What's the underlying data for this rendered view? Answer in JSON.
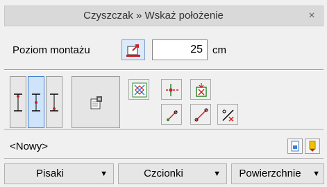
{
  "window": {
    "title": "Czyszczak » Wskaż położenie",
    "close_symbol": "×"
  },
  "level": {
    "label": "Poziom montażu",
    "value": "25",
    "unit": "cm",
    "icon": "mounting-level-icon"
  },
  "anchors": [
    {
      "name": "anchor-top",
      "active": false
    },
    {
      "name": "anchor-center",
      "active": true
    },
    {
      "name": "anchor-bottom",
      "active": false
    }
  ],
  "tools": {
    "properties_icon": "properties-icon",
    "icons": [
      "snap-cross-icon",
      "insert-point-icon",
      "place-on-axis-icon",
      "line-start-icon",
      "line-diagonal-icon",
      "line-end-icon"
    ]
  },
  "name_field": {
    "value": "<Nowy>",
    "copy_icon": "copy-page-icon",
    "tag_icon": "tag-icon"
  },
  "bottom_tabs": [
    {
      "label": "Pisaki"
    },
    {
      "label": "Czcionki"
    },
    {
      "label": "Powierzchnie"
    }
  ],
  "colors": {
    "accent": "#3c7fd1",
    "icon_red": "#d11c1c",
    "icon_green": "#2a8a2a"
  }
}
